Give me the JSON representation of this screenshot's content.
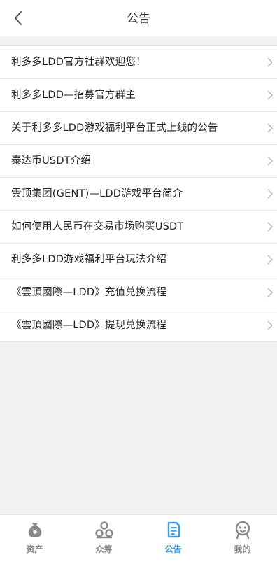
{
  "header": {
    "title": "公告"
  },
  "announcements": [
    {
      "title": "利多多LDD官方社群欢迎您！"
    },
    {
      "title": "利多多LDD—招募官方群主"
    },
    {
      "title": "关于利多多LDD游戏福利平台正式上线的公告"
    },
    {
      "title": "泰达币USDT介绍"
    },
    {
      "title": "雲顶集团(GENT)—LDD游戏平台简介"
    },
    {
      "title": "如何使用人民币在交易市场购买USDT"
    },
    {
      "title": "利多多LDD游戏福利平台玩法介绍"
    },
    {
      "title": "《雲頂國際—LDD》充值兑换流程"
    },
    {
      "title": "《雲頂國際—LDD》提现兑换流程"
    }
  ],
  "tabbar": {
    "tabs": [
      {
        "label": "资产",
        "icon": "money-bag-icon"
      },
      {
        "label": "众筹",
        "icon": "crowdfunding-icon"
      },
      {
        "label": "公告",
        "icon": "notice-document-icon"
      },
      {
        "label": "我的",
        "icon": "profile-avatar-icon"
      }
    ],
    "active_index": 2
  },
  "colors": {
    "accent": "#3a9be8",
    "inactive": "#8a8a8a",
    "background": "#f2f2f2"
  }
}
